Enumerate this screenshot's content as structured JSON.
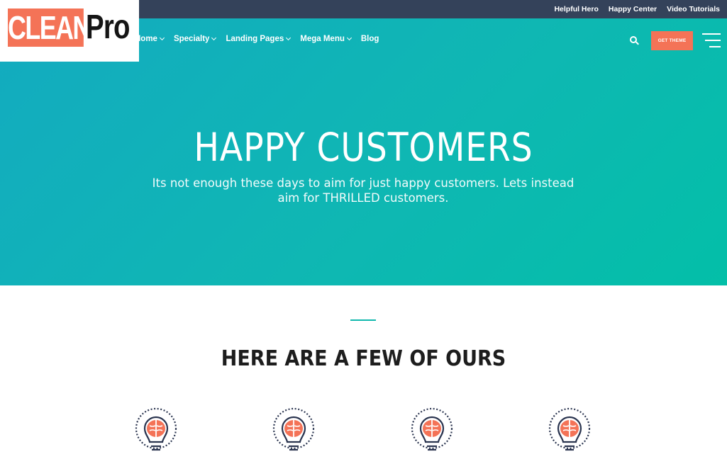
{
  "topbar": {
    "links": [
      "Helpful Hero",
      "Happy Center",
      "Video Tutorials"
    ]
  },
  "logo": {
    "part1": "CLEAN",
    "part2": "Pro"
  },
  "nav": {
    "items": [
      {
        "label": "Home",
        "has_dropdown": true
      },
      {
        "label": "Specialty",
        "has_dropdown": true
      },
      {
        "label": "Landing Pages",
        "has_dropdown": true
      },
      {
        "label": "Mega Menu",
        "has_dropdown": true
      },
      {
        "label": "Blog",
        "has_dropdown": false
      }
    ],
    "cta_label": "GET THEME"
  },
  "hero": {
    "title": "HAPPY CUSTOMERS",
    "subtitle": "Its not enough these days to aim for just happy customers. Lets instead aim for THRILLED customers."
  },
  "section": {
    "title": "HERE ARE A FEW OF OURS"
  },
  "icons": [
    "brain-bulb-icon",
    "brain-bulb-icon",
    "brain-bulb-icon",
    "brain-bulb-icon"
  ],
  "colors": {
    "topbar": "#34425a",
    "accent": "#f47357",
    "teal": "#0fb7b3",
    "divider": "#11b8ad"
  }
}
